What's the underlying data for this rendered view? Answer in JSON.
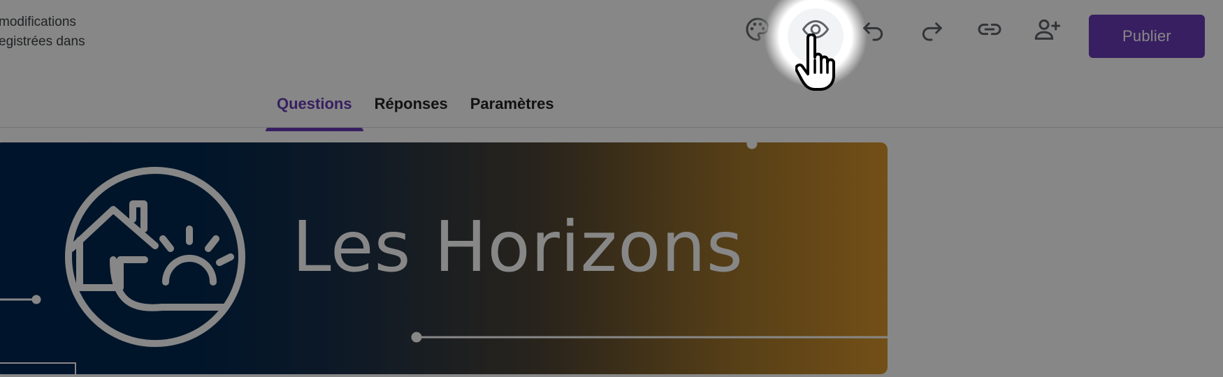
{
  "top_bar": {
    "save_status_line1": "modifications",
    "save_status_line2": "egistrées dans",
    "icons": [
      "palette-icon",
      "eye-icon",
      "undo-icon",
      "redo-icon",
      "link-icon",
      "add-person-icon"
    ],
    "publish_label": "Publier"
  },
  "tabs": [
    {
      "label": "Questions",
      "active": true
    },
    {
      "label": "Réponses",
      "active": false
    },
    {
      "label": "Paramètres",
      "active": false
    }
  ],
  "banner": {
    "title": "Les Horizons"
  },
  "colors": {
    "accent": "#673ab7",
    "banner_gradient_start": "#002652",
    "banner_gradient_end": "#d9962b"
  }
}
